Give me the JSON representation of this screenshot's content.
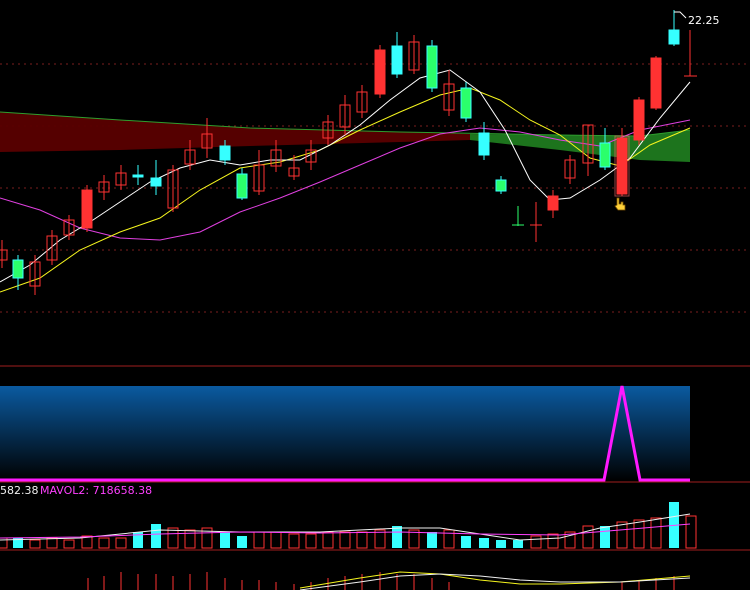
{
  "price_panel": {
    "high_label": "22.25"
  },
  "volume_panel": {
    "mavol1_label": "582.38",
    "mavol2_label": "MAVOL2: 718658.38"
  },
  "colors": {
    "up": "#ff3232",
    "down": "#36ffff",
    "down_fill_alt": "#2bff6b",
    "ma5": "#ffffff",
    "ma10": "#f5f51e",
    "ma20": "#e040e0",
    "cloud_red": "#5a0000",
    "cloud_green": "#1f7a1f",
    "signal_line": "#ff19ff",
    "grid": "#7a1e1e",
    "indicator_bg_top": "#0a5aa0",
    "indicator_bg_bottom": "#000000",
    "mavol1": "#f0f0f0",
    "mavol2": "#ff40ff"
  }
}
